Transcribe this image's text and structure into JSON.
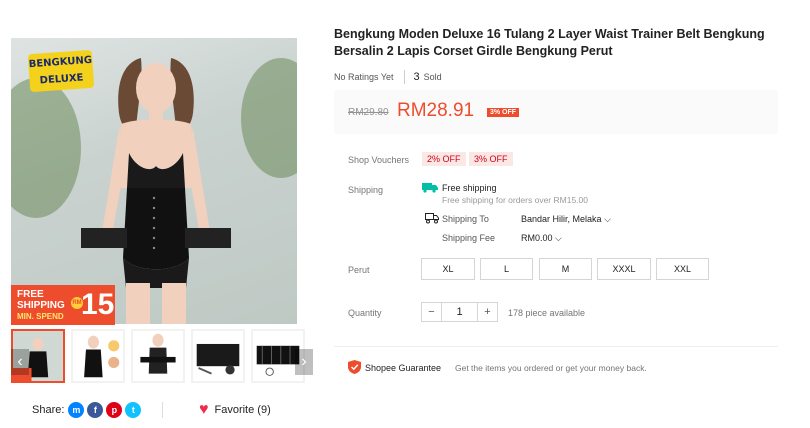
{
  "product": {
    "title": "Bengkung Moden Deluxe 16 Tulang 2 Layer Waist Trainer Belt Bengkung Bersalin 2 Lapis Corset Girdle Bengkung Perut",
    "ratings_text": "No Ratings Yet",
    "sold_count": "3",
    "sold_label": "Sold"
  },
  "image": {
    "badge_line1": "BENGKUNG",
    "badge_line2": "DELUXE",
    "promo_line1": "FREE",
    "promo_line2": "SHIPPING",
    "promo_min": "MIN. SPEND",
    "promo_amount": "15",
    "promo_currency": "RM"
  },
  "price": {
    "original": "RM29.80",
    "current": "RM28.91",
    "discount": "3% OFF"
  },
  "vouchers": {
    "label": "Shop Vouchers",
    "items": [
      "2% OFF",
      "3% OFF"
    ]
  },
  "shipping": {
    "label": "Shipping",
    "free_title": "Free shipping",
    "free_sub": "Free shipping for orders over RM15.00",
    "ship_to_label": "Shipping To",
    "ship_to_value": "Bandar Hilir, Melaka",
    "fee_label": "Shipping Fee",
    "fee_value": "RM0.00"
  },
  "variation": {
    "label": "Perut",
    "options": [
      "XL",
      "L",
      "M",
      "XXXL",
      "XXL"
    ]
  },
  "quantity": {
    "label": "Quantity",
    "minus": "−",
    "value": "1",
    "plus": "+",
    "available": "178 piece available"
  },
  "guarantee": {
    "title": "Shopee Guarantee",
    "subtitle": "Get the items you ordered or get your money back."
  },
  "share": {
    "label": "Share:",
    "icons": [
      "messenger-icon",
      "facebook-icon",
      "pinterest-icon",
      "twitter-icon"
    ]
  },
  "favorite": {
    "label": "Favorite (9)"
  },
  "colors": {
    "accent": "#ee4d2d",
    "voucher_bg": "#fbe7e3",
    "heart": "#ee2d4a"
  }
}
